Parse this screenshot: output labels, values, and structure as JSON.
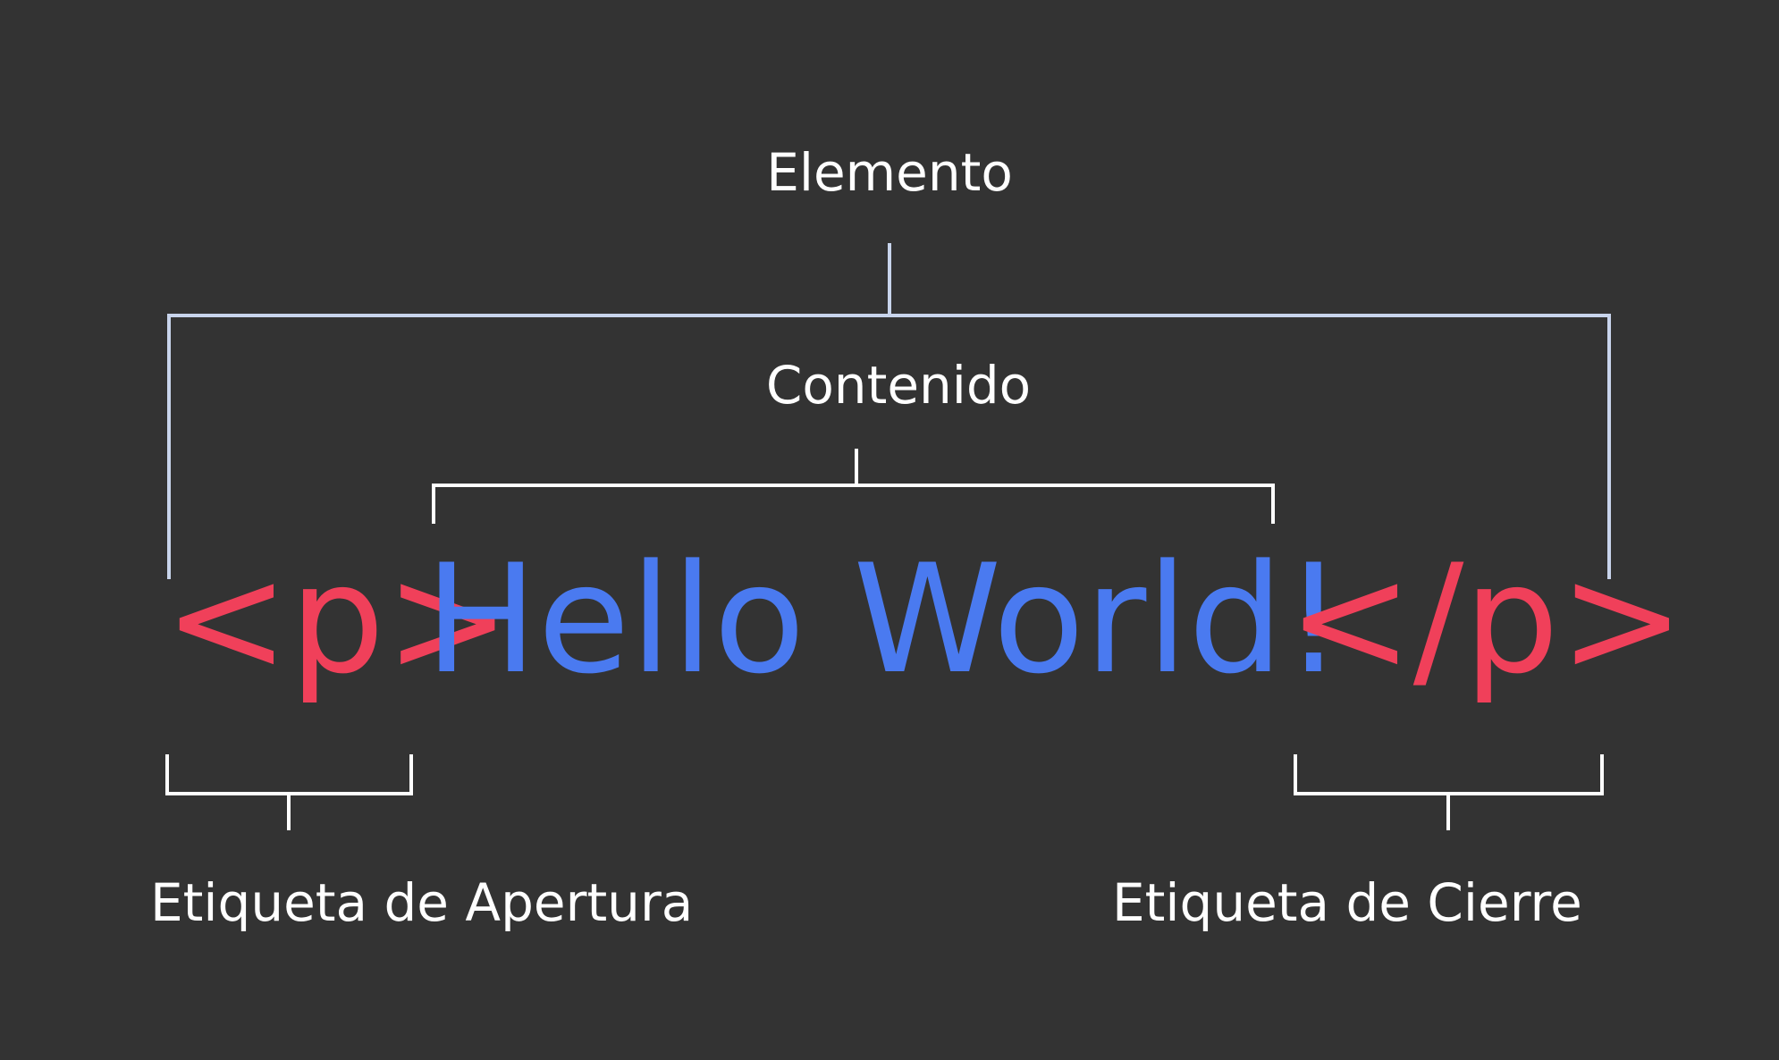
{
  "labels": {
    "element": "Elemento",
    "content": "Contenido",
    "opening_tag": "Etiqueta de Apertura",
    "closing_tag": "Etiqueta de Cierre"
  },
  "code": {
    "opening_tag": "<p>",
    "content": "Hello World!",
    "closing_tag": "</p>"
  },
  "colors": {
    "background": "#333333",
    "tag": "#f0405a",
    "content": "#4a7af0",
    "label": "#ffffff",
    "element_bracket": "#c8d4ec",
    "bracket": "#ffffff"
  }
}
